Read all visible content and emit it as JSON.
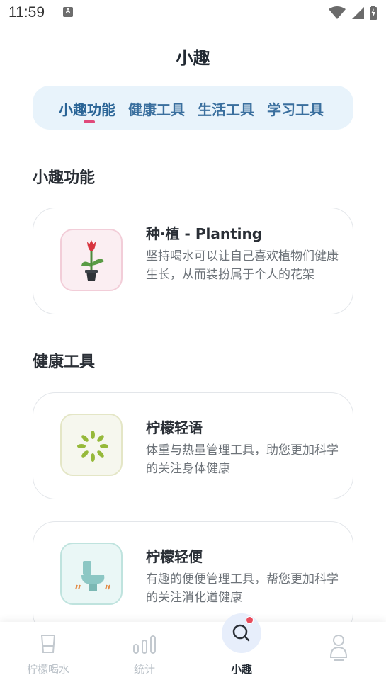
{
  "status_bar": {
    "time": "11:59",
    "app_icon_letter": "A",
    "icons": [
      "wifi-icon",
      "cellular-signal-icon",
      "battery-charging-icon"
    ]
  },
  "header": {
    "title": "小趣"
  },
  "tabs": [
    {
      "label": "小趣功能",
      "active": true
    },
    {
      "label": "健康工具",
      "active": false
    },
    {
      "label": "生活工具",
      "active": false
    },
    {
      "label": "学习工具",
      "active": false
    }
  ],
  "colors": {
    "tab_bg": "#e8f3fb",
    "tab_text": "#3a6f9e",
    "indicator": "#e0497a",
    "badge": "#e84b5c",
    "nav_inactive": "#b9c0c7"
  },
  "sections": [
    {
      "title": "小趣功能",
      "cards": [
        {
          "icon": "potted-tulip-icon",
          "title": "种·植 - Planting",
          "description": "坚持喝水可以让自己喜欢植物们健康生长，从而装扮属于个人的花架"
        }
      ]
    },
    {
      "title": "健康工具",
      "cards": [
        {
          "icon": "lemon-slice-icon",
          "title": "柠檬轻语",
          "description": "体重与热量管理工具，助您更加科学的关注身体健康"
        },
        {
          "icon": "toilet-icon",
          "title": "柠檬轻便",
          "description": "有趣的便便管理工具，帮您更加科学的关注消化道健康"
        }
      ]
    }
  ],
  "bottom_nav": [
    {
      "label": "柠檬喝水",
      "icon": "water-cup-icon",
      "active": false
    },
    {
      "label": "统计",
      "icon": "bar-chart-icon",
      "active": false
    },
    {
      "label": "小趣",
      "icon": "search-icon",
      "active": true
    },
    {
      "label": "",
      "icon": "profile-icon",
      "active": false
    }
  ]
}
